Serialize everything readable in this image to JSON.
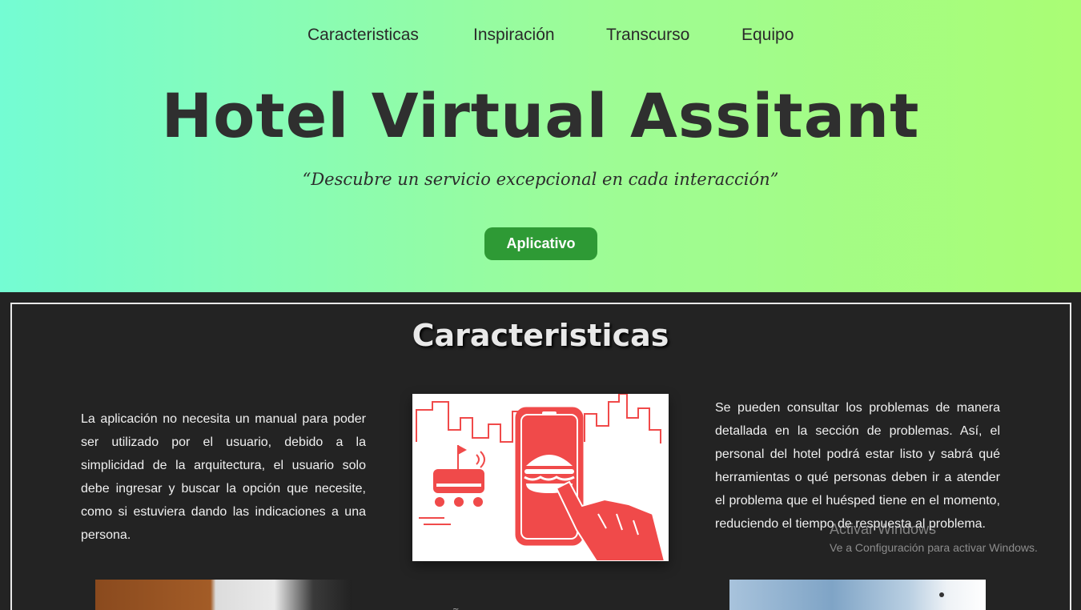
{
  "nav": {
    "items": [
      "Caracteristicas",
      "Inspiración",
      "Transcurso",
      "Equipo"
    ]
  },
  "hero": {
    "title": "Hotel Virtual Assitant",
    "quote": "“Descubre un servicio excepcional en cada interacción”",
    "cta_label": "Aplicativo"
  },
  "features": {
    "title": "Caracteristicas",
    "left_text": "La aplicación no necesita un manual para poder ser utilizado por el usuario, debido a la simplicidad de la arquitectura, el usuario solo debe ingresar y buscar la opción que necesite, como si estuviera dando las indicaciones a una persona.",
    "right_text": "Se pueden consultar los problemas de manera detallada en la sección de problemas. Así, el personal del hotel podrá estar listo y sabrá qué herramientas o qué personas deben ir a atender el problema que el huésped tiene en el momento, reduciendo el tiempo de respuesta al problema.",
    "mid_mark": "~"
  },
  "watermark": {
    "title": "Activar Windows",
    "subtitle": "Ve a Configuración para activar Windows."
  },
  "colors": {
    "hero_gradient_start": "#74fcd3",
    "hero_gradient_end": "#aafd74",
    "cta_green": "#2e9a35",
    "section_bg": "#232323",
    "illustration_red": "#f04a4a"
  },
  "icons": {
    "illustration": "delivery-robot-phone-burger-illustration"
  }
}
